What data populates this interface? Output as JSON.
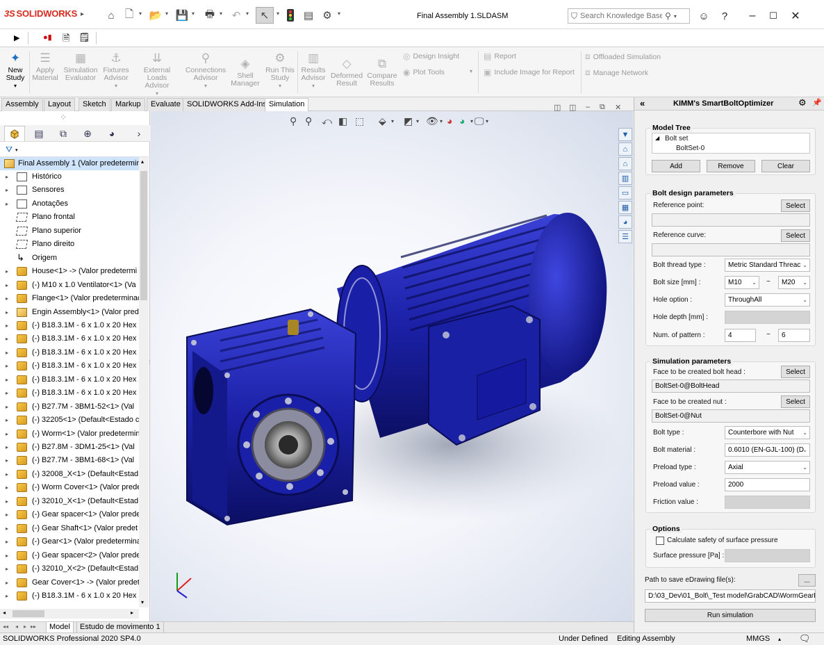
{
  "app": {
    "logo": "SOLIDWORKS",
    "logo_prefix": "3S",
    "document_title": "Final Assembly 1.SLDASM",
    "search_placeholder": "Search Knowledge Base"
  },
  "ribbon": {
    "buttons": [
      {
        "label1": "New",
        "label2": "Study",
        "enabled": true
      },
      {
        "label1": "Apply",
        "label2": "Material",
        "enabled": false
      },
      {
        "label1": "Simulation",
        "label2": "Evaluator",
        "enabled": false
      },
      {
        "label1": "Fixtures",
        "label2": "Advisor",
        "enabled": false
      },
      {
        "label1": "External Loads",
        "label2": "Advisor",
        "enabled": false
      },
      {
        "label1": "Connections",
        "label2": "Advisor",
        "enabled": false
      },
      {
        "label1": "Shell",
        "label2": "Manager",
        "enabled": false
      },
      {
        "label1": "Run This",
        "label2": "Study",
        "enabled": false
      },
      {
        "label1": "Results",
        "label2": "Advisor",
        "enabled": false
      },
      {
        "label1": "Deformed",
        "label2": "Result",
        "enabled": false
      },
      {
        "label1": "Compare",
        "label2": "Results",
        "enabled": false
      }
    ],
    "small_items": [
      "Design Insight",
      "Plot Tools",
      "Report",
      "Include Image for Report",
      "Offloaded Simulation",
      "Manage Network"
    ]
  },
  "tabs": [
    "Assembly",
    "Layout",
    "Sketch",
    "Markup",
    "Evaluate",
    "SOLIDWORKS Add-Ins",
    "Simulation"
  ],
  "active_tab": "Simulation",
  "feature_tree": {
    "root": "Final Assembly 1  (Valor predetermin",
    "items": [
      {
        "label": "Histórico",
        "icon": "folder"
      },
      {
        "label": "Sensores",
        "icon": "folder"
      },
      {
        "label": "Anotações",
        "icon": "folder"
      },
      {
        "label": "Plano frontal",
        "icon": "plane"
      },
      {
        "label": "Plano superior",
        "icon": "plane"
      },
      {
        "label": "Plano direito",
        "icon": "plane"
      },
      {
        "label": "Origem",
        "icon": "origin"
      },
      {
        "label": "House<1> -> (Valor predetermi",
        "icon": "part"
      },
      {
        "label": "(-) M10 x 1.0 Ventilator<1> (Va",
        "icon": "part"
      },
      {
        "label": "Flange<1> (Valor predeterminac",
        "icon": "part"
      },
      {
        "label": "Engin Assembly<1> (Valor prede",
        "icon": "asm"
      },
      {
        "label": "(-) B18.3.1M - 6 x 1.0 x 20 Hex",
        "icon": "part"
      },
      {
        "label": "(-) B18.3.1M - 6 x 1.0 x 20 Hex",
        "icon": "part"
      },
      {
        "label": "(-) B18.3.1M - 6 x 1.0 x 20 Hex",
        "icon": "part"
      },
      {
        "label": "(-) B18.3.1M - 6 x 1.0 x 20 Hex",
        "icon": "part"
      },
      {
        "label": "(-) B18.3.1M - 6 x 1.0 x 20 Hex",
        "icon": "part"
      },
      {
        "label": "(-) B18.3.1M - 6 x 1.0 x 20 Hex",
        "icon": "part"
      },
      {
        "label": "(-) B27.7M - 3BM1-52<1> (Val",
        "icon": "part"
      },
      {
        "label": "(-) 32205<1> (Default<Estado c",
        "icon": "part"
      },
      {
        "label": "(-) Worm<1> (Valor predetermin",
        "icon": "part"
      },
      {
        "label": "(-) B27.8M - 3DM1-25<1> (Val",
        "icon": "part"
      },
      {
        "label": "(-) B27.7M - 3BM1-68<1> (Val",
        "icon": "part"
      },
      {
        "label": "(-) 32008_X<1> (Default<Estad",
        "icon": "part"
      },
      {
        "label": "(-) Worm Cover<1> (Valor prede",
        "icon": "part"
      },
      {
        "label": "(-) 32010_X<1> (Default<Estad",
        "icon": "part"
      },
      {
        "label": "(-) Gear spacer<1> (Valor predet",
        "icon": "part"
      },
      {
        "label": "(-) Gear Shaft<1> (Valor predet",
        "icon": "part"
      },
      {
        "label": "(-) Gear<1> (Valor predetermina",
        "icon": "part"
      },
      {
        "label": "(-) Gear spacer<2> (Valor predet",
        "icon": "part"
      },
      {
        "label": "(-) 32010_X<2> (Default<Estad",
        "icon": "part"
      },
      {
        "label": "Gear Cover<1> -> (Valor predet",
        "icon": "part"
      },
      {
        "label": "(-) B18.3.1M - 6 x 1.0 x 20 Hex",
        "icon": "part"
      }
    ]
  },
  "bottom_tabs": [
    "Model",
    "Estudo de movimento 1"
  ],
  "status": {
    "product": "SOLIDWORKS Professional 2020 SP4.0",
    "state": "Under Defined",
    "mode": "Editing Assembly",
    "units": "MMGS"
  },
  "panel": {
    "title": "KIMM's SmartBoltOptimizer",
    "model_tree": {
      "title": "Model Tree",
      "node": "Bolt set",
      "child": "BoltSet-0",
      "add": "Add",
      "remove": "Remove",
      "clear": "Clear"
    },
    "design": {
      "title": "Bolt design parameters",
      "reference_point": "Reference point:",
      "reference_curve": "Reference curve:",
      "select": "Select",
      "thread_type_label": "Bolt thread type :",
      "thread_type_value": "Metric Standard Threac",
      "size_label": "Bolt size [mm] :",
      "size_from": "M10",
      "size_to": "M20",
      "range_sep": "~",
      "hole_option_label": "Hole option :",
      "hole_option_value": "ThroughAll",
      "hole_depth_label": "Hole depth [mm] :",
      "pattern_label": "Num. of pattern :",
      "pattern_from": "4",
      "pattern_to": "6"
    },
    "simulation": {
      "title": "Simulation parameters",
      "bolt_head_label": "Face to be created bolt head :",
      "bolt_head_value": "BoltSet-0@BoltHead",
      "nut_label": "Face to be created nut :",
      "nut_value": "BoltSet-0@Nut",
      "bolt_type_label": "Bolt type :",
      "bolt_type_value": "Counterbore with Nut",
      "material_label": "Bolt material :",
      "material_value": "0.6010 (EN-GJL-100) (D",
      "preload_type_label": "Preload type :",
      "preload_type_value": "Axial",
      "preload_value_label": "Preload value :",
      "preload_value": "2000",
      "friction_label": "Friction value :"
    },
    "options": {
      "title": "Options",
      "surface_check_label": "Calculate safety of surface pressure",
      "surface_pressure_label": "Surface pressure [Pa] :"
    },
    "path_label": "Path to save eDrawing file(s):",
    "browse": "...",
    "path_value": "D:\\03_Dev\\01_Bolt\\_Test model\\GrabCAD\\WormGearRec",
    "run": "Run simulation"
  },
  "colors": {
    "accent": "#1f6fc4",
    "model_blue": "#1a1fa8",
    "logo_red": "#d52b1e"
  }
}
